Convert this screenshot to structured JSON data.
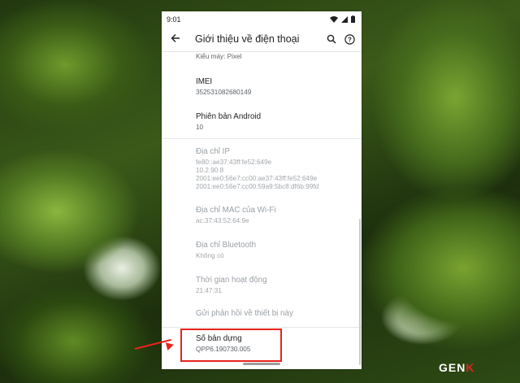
{
  "status_bar": {
    "time": "9:01"
  },
  "app_bar": {
    "title": "Giới thiệu về điện thoại"
  },
  "settings": {
    "model_partial": "Kiểu máy: Pixel",
    "imei": {
      "label": "IMEI",
      "value": "352531082680149"
    },
    "android_version": {
      "label": "Phiên bản Android",
      "value": "10"
    },
    "ip_address": {
      "label": "Địa chỉ IP",
      "lines": [
        "fe80::ae37:43ff:fe52:649e",
        "10.2.90.8",
        "2001:ee0:56e7:cc00:ae37:43ff:fe52:649e",
        "2001:ee0:56e7:cc00:59a9:5bc8:df6b:99fd"
      ]
    },
    "wifi_mac": {
      "label": "Địa chỉ MAC của Wi-Fi",
      "value": "ac:37:43:52:64:9e"
    },
    "bluetooth": {
      "label": "Địa chỉ Bluetooth",
      "value": "Không có"
    },
    "uptime": {
      "label": "Thời gian hoạt động",
      "value": "21:47:31"
    },
    "feedback": {
      "label": "Gửi phản hồi về thiết bị này"
    },
    "build_number": {
      "label": "Số bản dựng",
      "value": "QPP6.190730.005"
    }
  },
  "watermark": {
    "text_main": "GEN",
    "text_accent": "K"
  },
  "colors": {
    "highlight": "#e8221d",
    "watermark_accent": "#d42a24"
  }
}
